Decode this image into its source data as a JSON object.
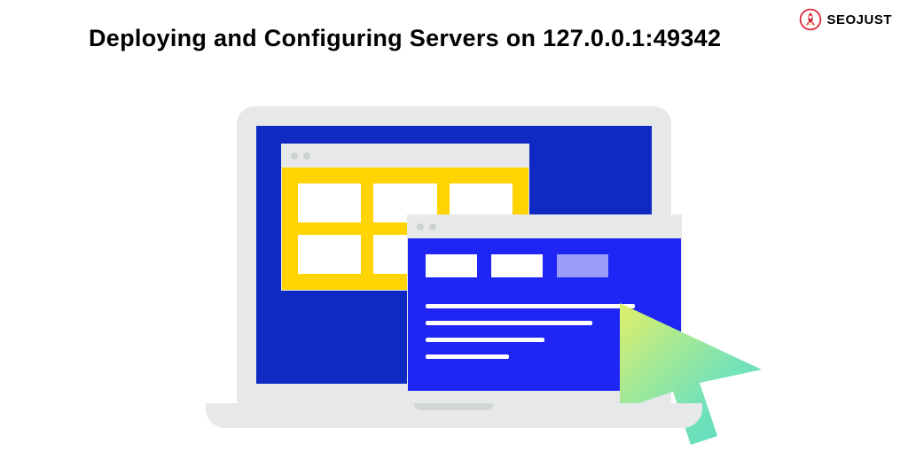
{
  "logo": {
    "brand": "SEOJUST",
    "icon_name": "rocket-icon"
  },
  "heading": "Deploying and Configuring Servers on 127.0.0.1:49342",
  "illustration": {
    "back_window": {
      "type": "grid",
      "rows": 2,
      "cols": 3
    },
    "front_window": {
      "tabs_count": 3,
      "text_lines": 4
    },
    "cursor": "arrow-cursor"
  },
  "colors": {
    "screen": "#0e2ac2",
    "back_window": "#ffd400",
    "front_window": "#1e25f5",
    "laptop": "#e6e8e9"
  }
}
